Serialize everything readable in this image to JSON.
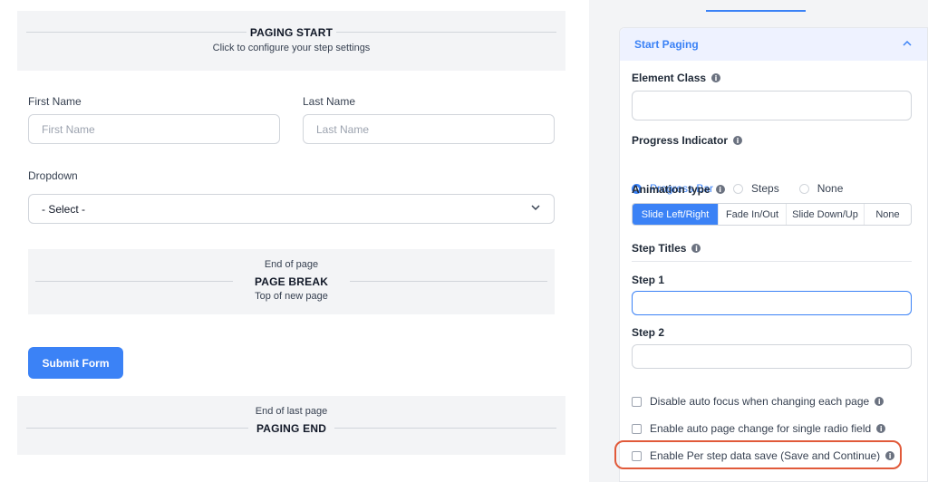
{
  "canvas": {
    "paging_start": {
      "title": "PAGING START",
      "subtitle": "Click to configure your step settings"
    },
    "first_name": {
      "label": "First Name",
      "placeholder": "First Name"
    },
    "last_name": {
      "label": "Last Name",
      "placeholder": "Last Name"
    },
    "dropdown": {
      "label": "Dropdown",
      "selected": "- Select -"
    },
    "page_break": {
      "top_text": "End of page",
      "title": "PAGE BREAK",
      "bottom_text": "Top of new page"
    },
    "submit_label": "Submit Form",
    "paging_end": {
      "top_text": "End of last page",
      "title": "PAGING END"
    }
  },
  "panel": {
    "section_title": "Start Paging",
    "element_class": {
      "label": "Element Class",
      "value": ""
    },
    "progress_indicator": {
      "label": "Progress Indicator",
      "options": [
        "Progress Bar",
        "Steps",
        "None"
      ],
      "selected": "Progress Bar"
    },
    "animation_type": {
      "label": "Animation type",
      "options": [
        "Slide Left/Right",
        "Fade In/Out",
        "Slide Down/Up",
        "None"
      ],
      "selected": "Slide Left/Right"
    },
    "step_titles": {
      "label": "Step Titles"
    },
    "step1": {
      "label": "Step 1",
      "value": ""
    },
    "step2": {
      "label": "Step 2",
      "value": ""
    },
    "checkboxes": [
      {
        "label": "Disable auto focus when changing each page",
        "checked": false
      },
      {
        "label": "Enable auto page change for single radio field",
        "checked": false
      },
      {
        "label": "Enable Per step data save (Save and Continue)",
        "checked": false
      }
    ]
  },
  "colors": {
    "accent": "#3b82f6",
    "highlight": "#e15a3a",
    "panel_bg": "#f3f4f6"
  }
}
